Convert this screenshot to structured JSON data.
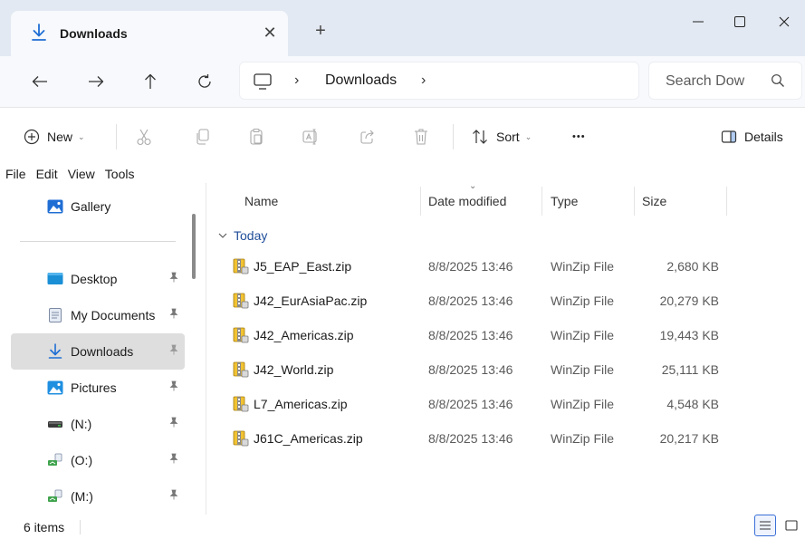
{
  "tab": {
    "title": "Downloads",
    "close_glyph": "✕",
    "new_tab_glyph": "+"
  },
  "window": {
    "minimize": "—",
    "maximize": "☐",
    "close": "✕"
  },
  "nav": {
    "back_glyph": "←",
    "forward_glyph": "→",
    "up_glyph": "↑",
    "refresh_glyph": "↻"
  },
  "address": {
    "separator": "›",
    "crumb": "Downloads"
  },
  "search": {
    "placeholder": "Search Dow"
  },
  "toolbar": {
    "new_label": "New",
    "sort_label": "Sort",
    "more_glyph": "•••",
    "details_label": "Details",
    "chevron": "⌄"
  },
  "menu": [
    "File",
    "Edit",
    "View",
    "Tools"
  ],
  "sidebar": {
    "items": [
      {
        "label": "Gallery",
        "icon": "gallery-icon",
        "pinned": false
      },
      {
        "label": "Desktop",
        "icon": "desktop-icon",
        "pinned": true
      },
      {
        "label": "My Documents",
        "icon": "documents-icon",
        "pinned": true
      },
      {
        "label": "Downloads",
        "icon": "downloads-icon",
        "pinned": true,
        "selected": true
      },
      {
        "label": "Pictures",
        "icon": "pictures-icon",
        "pinned": true
      },
      {
        "label": "(N:)",
        "icon": "drive-icon",
        "pinned": true
      },
      {
        "label": "(O:)",
        "icon": "network-drive-icon",
        "pinned": true
      },
      {
        "label": "(M:)",
        "icon": "network-drive-icon",
        "pinned": true
      }
    ],
    "pin_glyph": "📌"
  },
  "columns": {
    "name": "Name",
    "date": "Date modified",
    "type": "Type",
    "size": "Size"
  },
  "group": {
    "label": "Today",
    "glyph": "⌄"
  },
  "files": [
    {
      "name": "J5_EAP_East.zip",
      "date": "8/8/2025 13:46",
      "type": "WinZip File",
      "size": "2,680 KB"
    },
    {
      "name": "J42_EurAsiaPac.zip",
      "date": "8/8/2025 13:46",
      "type": "WinZip File",
      "size": "20,279 KB"
    },
    {
      "name": "J42_Americas.zip",
      "date": "8/8/2025 13:46",
      "type": "WinZip File",
      "size": "19,443 KB"
    },
    {
      "name": "J42_World.zip",
      "date": "8/8/2025 13:46",
      "type": "WinZip File",
      "size": "25,111 KB"
    },
    {
      "name": "L7_Americas.zip",
      "date": "8/8/2025 13:46",
      "type": "WinZip File",
      "size": "4,548 KB"
    },
    {
      "name": "J61C_Americas.zip",
      "date": "8/8/2025 13:46",
      "type": "WinZip File",
      "size": "20,217 KB"
    }
  ],
  "status": {
    "text": "6 items"
  },
  "colors": {
    "accent": "#1f6ed4",
    "titlebar": "#e3e9f2",
    "navbar": "#f7f9fc",
    "selected": "#dedede",
    "group": "#1f4d99"
  }
}
